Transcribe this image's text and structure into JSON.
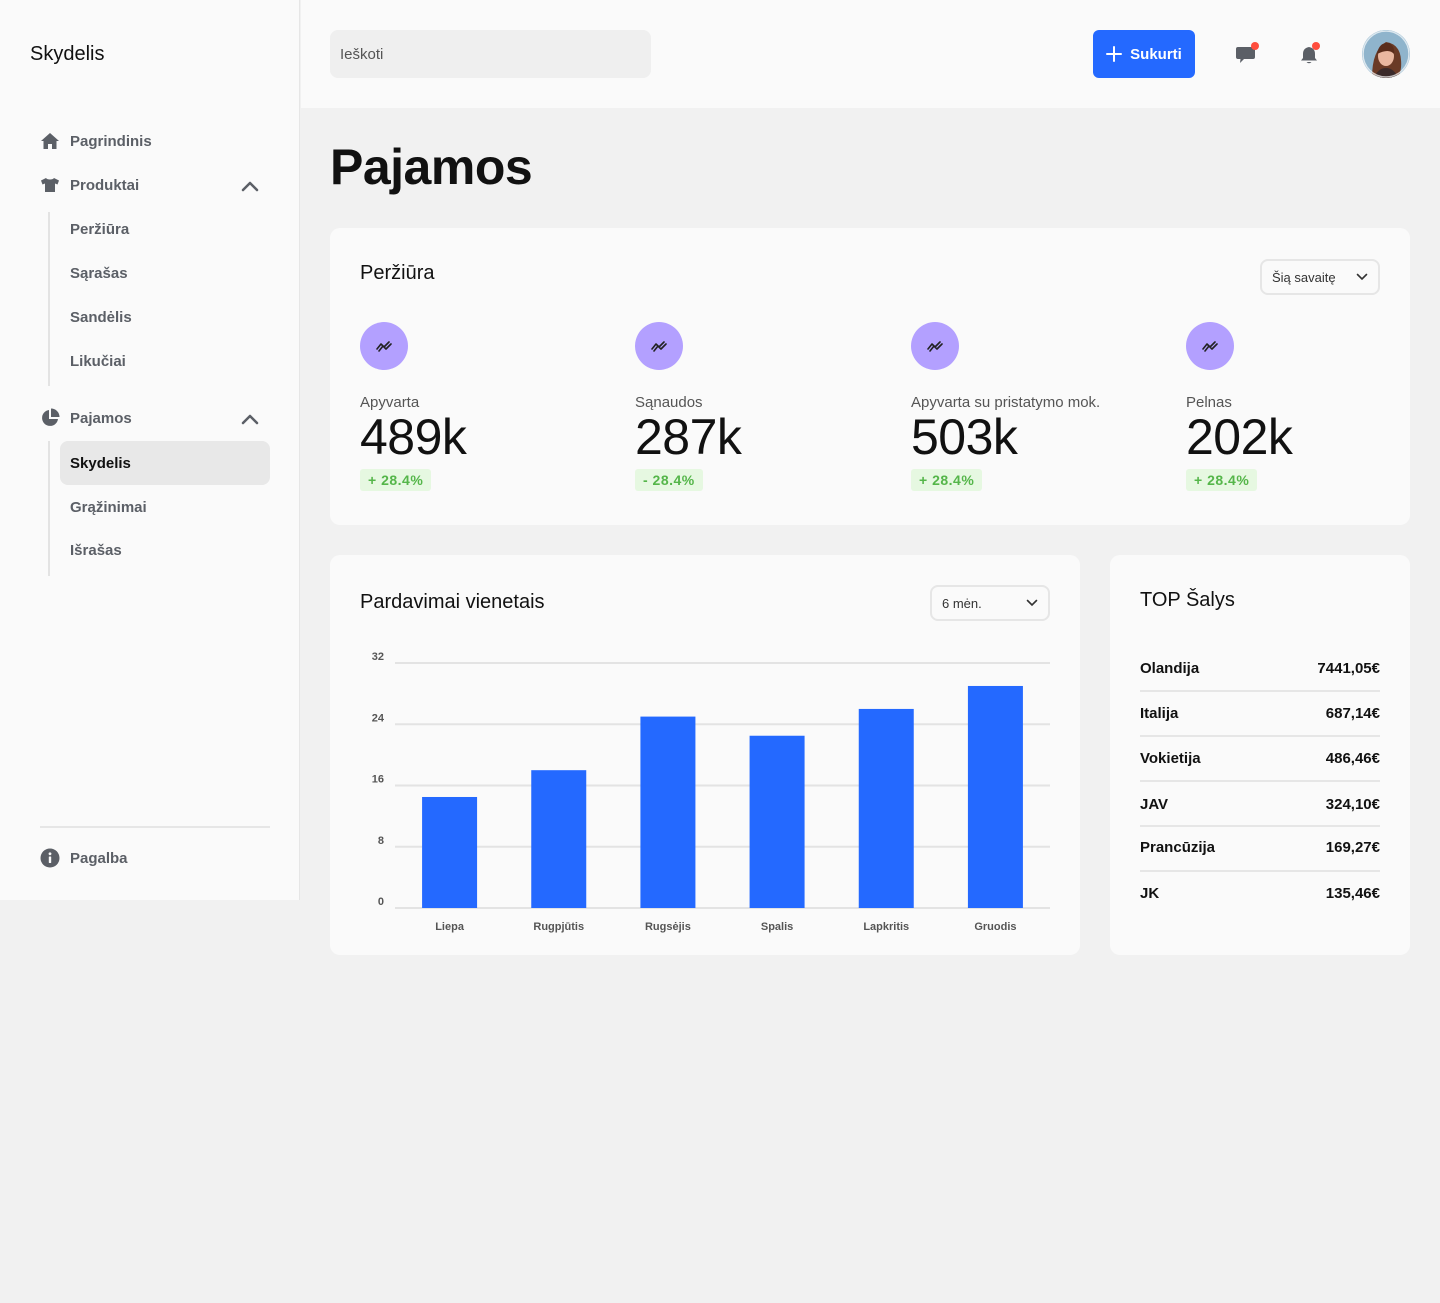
{
  "sidebar": {
    "brand": "Skydelis",
    "home_label": "Pagrindinis",
    "products_label": "Produktai",
    "products_items": [
      "Peržiūra",
      "Sąrašas",
      "Sandėlis",
      "Likučiai"
    ],
    "revenue_label": "Pajamos",
    "revenue_items": [
      "Skydelis",
      "Grąžinimai",
      "Išrašas"
    ],
    "help_label": "Pagalba"
  },
  "header": {
    "search_placeholder": "Ieškoti",
    "create_label": "Sukurti",
    "accent_color": "#2469ff",
    "notification_dot_color": "#ff4d3d"
  },
  "page": {
    "title": "Pajamos"
  },
  "overview": {
    "title": "Peržiūra",
    "period": "Šią savaitę",
    "stats": [
      {
        "label": "Apyvarta",
        "value": "489k",
        "change": "+ 28.4%"
      },
      {
        "label": "Sąnaudos",
        "value": "287k",
        "change": "- 28.4%"
      },
      {
        "label": "Apyvarta su pristatymo mok.",
        "value": "503k",
        "change": "+ 28.4%"
      },
      {
        "label": "Pelnas",
        "value": "202k",
        "change": "+ 28.4%"
      }
    ]
  },
  "sales": {
    "title": "Pardavimai vienetais",
    "period": "6 mėn."
  },
  "chart_data": {
    "type": "bar",
    "title": "Pardavimai vienetais",
    "categories": [
      "Liepa",
      "Rugpjūtis",
      "Rugsėjis",
      "Spalis",
      "Lapkritis",
      "Gruodis"
    ],
    "values": [
      14.5,
      18,
      25,
      22.5,
      26,
      29
    ],
    "ylim": [
      0,
      32
    ],
    "yticks": [
      "32",
      "24",
      "16",
      "8",
      "0"
    ],
    "ytick_values": [
      32,
      24,
      16,
      8,
      0
    ],
    "grid": true,
    "bar_color": "#2469ff"
  },
  "countries": {
    "title": "TOP Šalys",
    "rows": [
      {
        "name": "Olandija",
        "amount": "7441,05€"
      },
      {
        "name": "Italija",
        "amount": "687,14€"
      },
      {
        "name": "Vokietija",
        "amount": "486,46€"
      },
      {
        "name": "JAV",
        "amount": "324,10€"
      },
      {
        "name": "Prancūzija",
        "amount": "169,27€"
      },
      {
        "name": "JK",
        "amount": "135,46€"
      }
    ]
  }
}
